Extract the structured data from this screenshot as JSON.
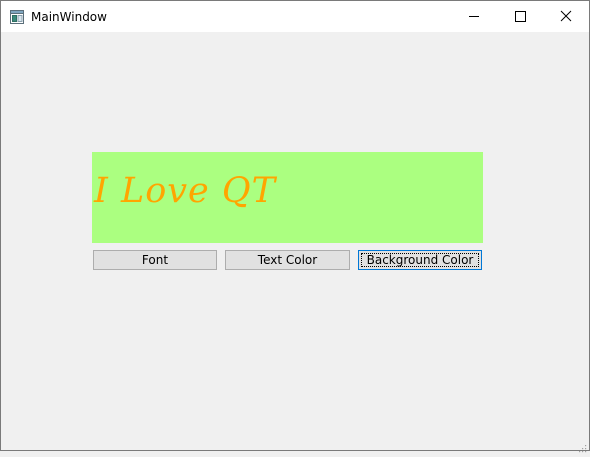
{
  "window": {
    "title": "MainWindow",
    "app_icon": "qt-window-icon",
    "controls": {
      "minimize_icon": "minimize-icon",
      "maximize_icon": "maximize-icon",
      "close_icon": "close-icon"
    }
  },
  "label": {
    "text": "I Love QT",
    "text_color": "#ffa500",
    "background_color": "#abff80"
  },
  "buttons": {
    "font": "Font",
    "text_color": "Text Color",
    "background_color": "Background Color"
  },
  "colors": {
    "window_bg": "#f0f0f0",
    "button_bg": "#e1e1e1",
    "focus_border": "#0078d7"
  }
}
